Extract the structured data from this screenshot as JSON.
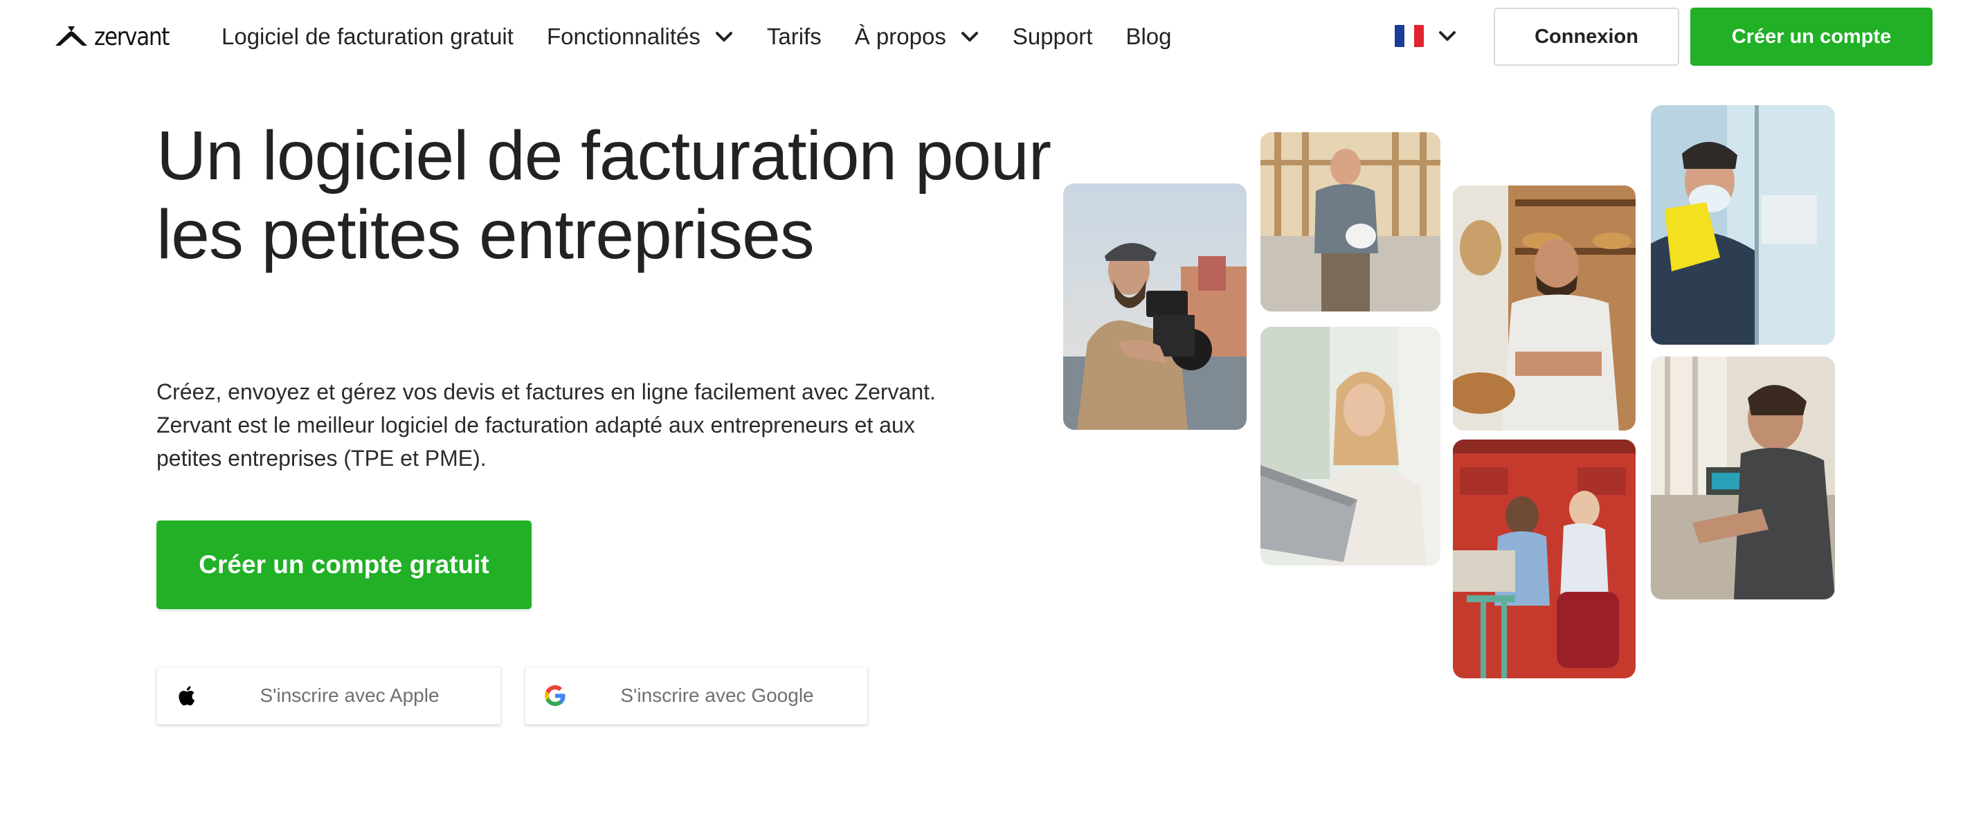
{
  "brand": {
    "name": "zervant",
    "logo_icon": "zervant-logo-mark"
  },
  "nav": {
    "items": [
      {
        "label": "Logiciel de facturation gratuit",
        "has_dropdown": false
      },
      {
        "label": "Fonctionnalités",
        "has_dropdown": true
      },
      {
        "label": "Tarifs",
        "has_dropdown": false
      },
      {
        "label": "À propos",
        "has_dropdown": true
      },
      {
        "label": "Support",
        "has_dropdown": false
      },
      {
        "label": "Blog",
        "has_dropdown": false
      }
    ],
    "language": {
      "icon": "france-flag-icon",
      "selected": "FR"
    },
    "login_label": "Connexion",
    "signup_label": "Créer un compte"
  },
  "hero": {
    "title": "Un logiciel de facturation pour les petites entreprises",
    "description": "Créez, envoyez et gérez vos devis et factures en ligne facilement avec Zervant. Zervant est le meilleur logiciel de facturation adapté aux entrepreneurs et aux petites entreprises (TPE et PME).",
    "cta_label": "Créer un compte gratuit",
    "apple_label": "S'inscrire avec Apple",
    "google_label": "S'inscrire avec Google"
  },
  "colors": {
    "accent_green": "#21b026",
    "text": "#222222",
    "muted_text": "#6f6f6f",
    "border": "#d9d9d9"
  }
}
